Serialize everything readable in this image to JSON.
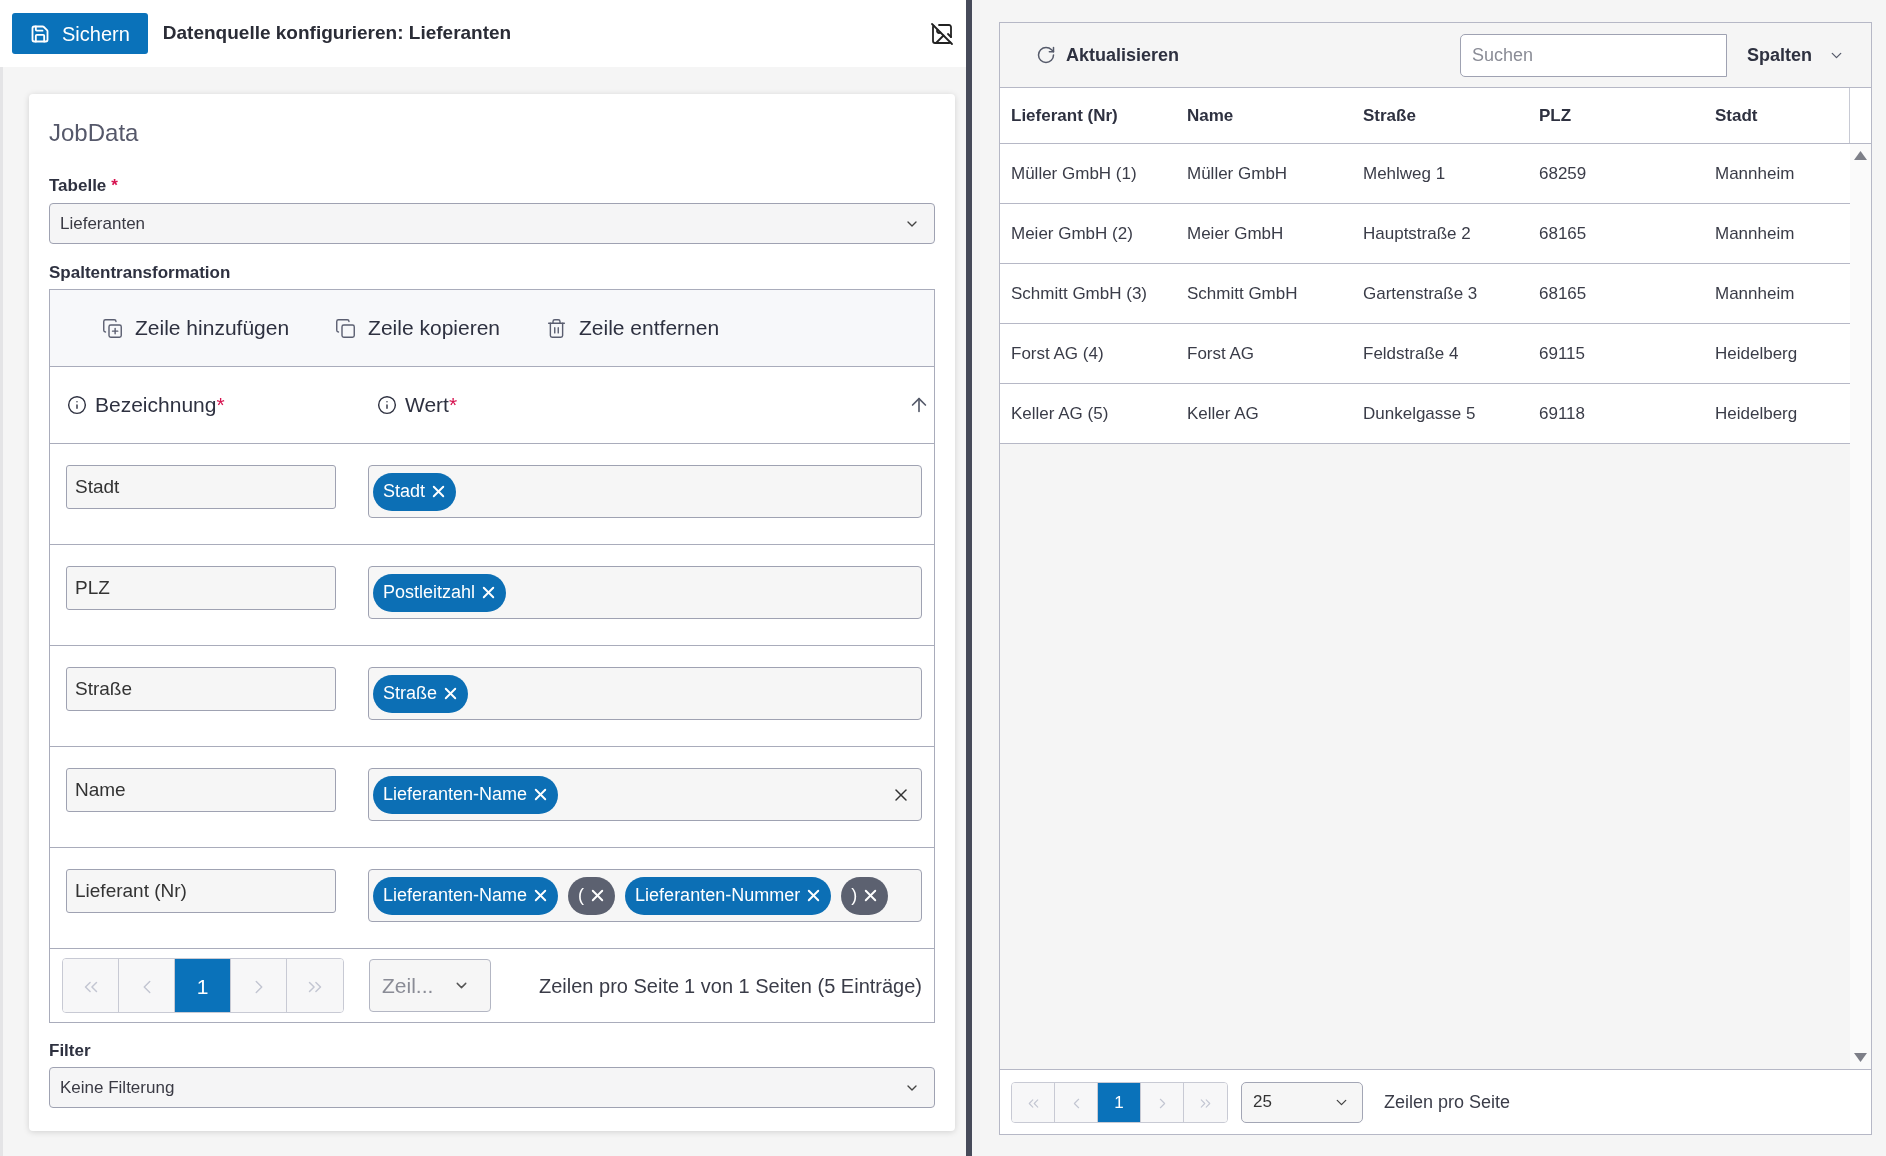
{
  "toolbar": {
    "save_button": "Sichern",
    "title": "Datenquelle konfigurieren: Lieferanten"
  },
  "form": {
    "section_title": "JobData",
    "table_field": {
      "label": "Tabelle",
      "required_mark": "*",
      "value": "Lieferanten"
    },
    "transform": {
      "label": "Spaltentransformation",
      "actions": [
        {
          "kind": "add",
          "label": "Zeile hinzufügen"
        },
        {
          "kind": "copy",
          "label": "Zeile kopieren"
        },
        {
          "kind": "remove",
          "label": "Zeile entfernen"
        }
      ],
      "columns": [
        {
          "label": "Bezeichnung",
          "required_mark": "*"
        },
        {
          "label": "Wert",
          "required_mark": "*"
        }
      ],
      "rows": [
        {
          "name": "Stadt",
          "clearable": false,
          "tokens": [
            {
              "kind": "field",
              "label": "Stadt"
            }
          ]
        },
        {
          "name": "PLZ",
          "clearable": false,
          "tokens": [
            {
              "kind": "field",
              "label": "Postleitzahl"
            }
          ]
        },
        {
          "name": "Straße",
          "clearable": false,
          "tokens": [
            {
              "kind": "field",
              "label": "Straße"
            }
          ]
        },
        {
          "name": "Name",
          "clearable": true,
          "tokens": [
            {
              "kind": "field",
              "label": "Lieferanten-Name"
            }
          ]
        },
        {
          "name": "Lieferant (Nr)",
          "clearable": false,
          "tokens": [
            {
              "kind": "field",
              "label": "Lieferanten-Name"
            },
            {
              "kind": "literal",
              "label": "("
            },
            {
              "kind": "field",
              "label": "Lieferanten-Nummer"
            },
            {
              "kind": "literal",
              "label": ")"
            }
          ]
        }
      ],
      "pager": {
        "nav_disabled": true,
        "pages": [
          {
            "label": "1",
            "selected": true
          }
        ]
      },
      "page_size": {
        "placeholder": "Zeil..."
      },
      "page_size_label": "Zeilen pro Seite",
      "page_info": "1 von 1 Seiten (5 Einträge)"
    },
    "filter_field": {
      "label": "Filter",
      "value": "Keine Filterung"
    }
  },
  "preview": {
    "refresh_button": "Aktualisieren",
    "search": {
      "placeholder": "Suchen"
    },
    "columns_button": "Spalten",
    "table": {
      "columns": [
        "Lieferant (Nr)",
        "Name",
        "Straße",
        "PLZ",
        "Stadt"
      ],
      "rows": [
        [
          "Müller GmbH (1)",
          "Müller GmbH",
          "Mehlweg 1",
          "68259",
          "Mannheim"
        ],
        [
          "Meier GmbH (2)",
          "Meier GmbH",
          "Hauptstraße 2",
          "68165",
          "Mannheim"
        ],
        [
          "Schmitt GmbH (3)",
          "Schmitt GmbH",
          "Gartenstraße 3",
          "68165",
          "Mannheim"
        ],
        [
          "Forst AG (4)",
          "Forst AG",
          "Feldstraße 4",
          "69115",
          "Heidelberg"
        ],
        [
          "Keller AG (5)",
          "Keller AG",
          "Dunkelgasse 5",
          "69118",
          "Heidelberg"
        ]
      ]
    },
    "pager": {
      "nav_disabled": true,
      "pages": [
        {
          "label": "1",
          "selected": true
        }
      ]
    },
    "page_size": {
      "value": "25"
    },
    "page_size_label": "Zeilen pro Seite"
  }
}
